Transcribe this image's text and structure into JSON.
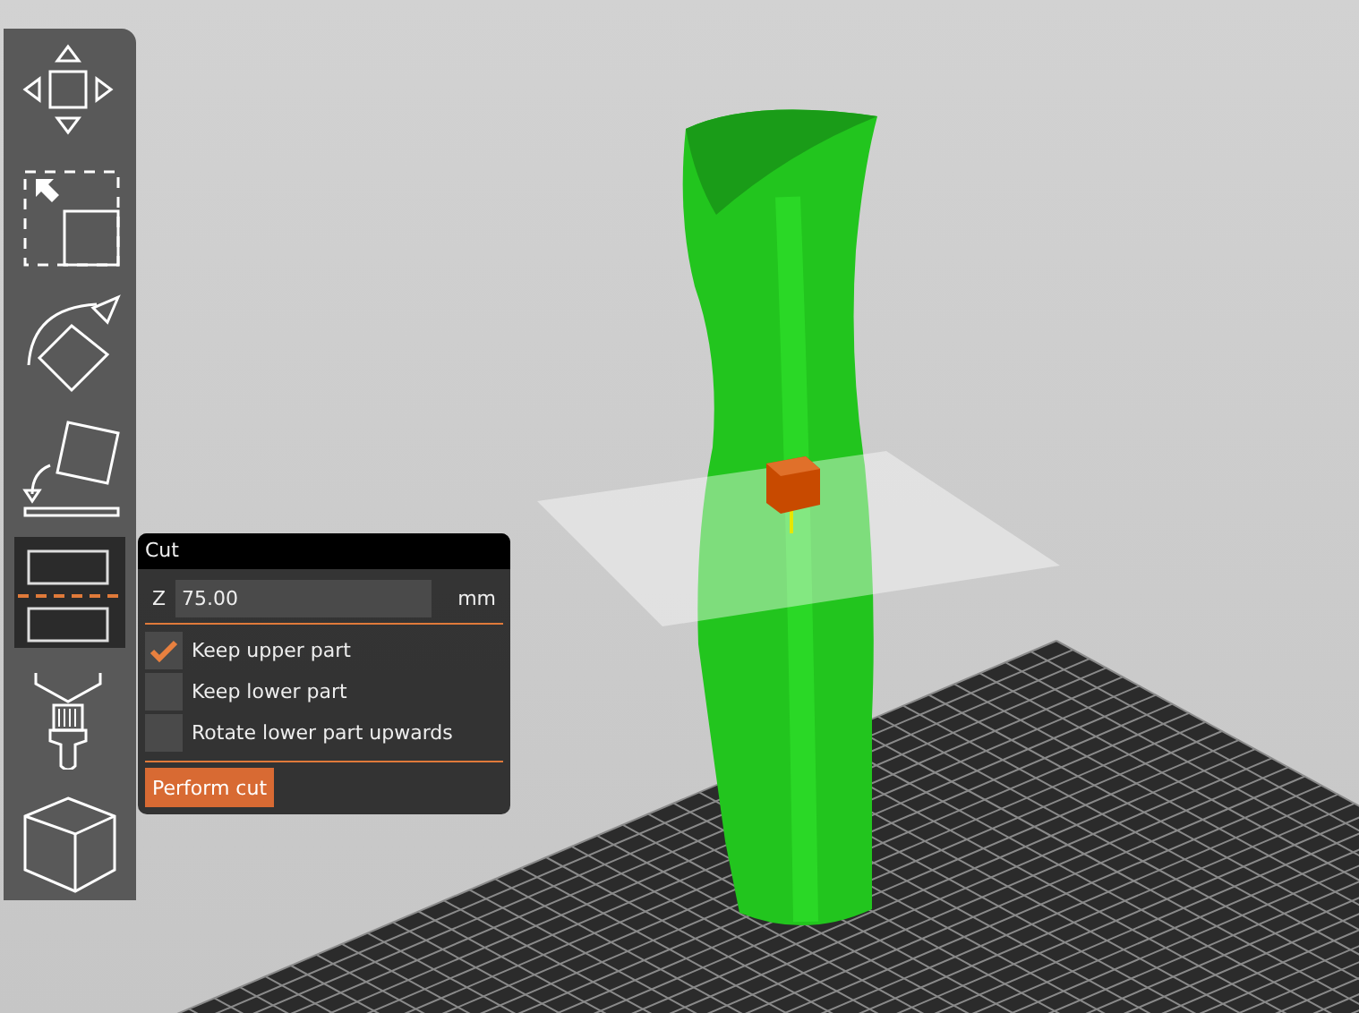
{
  "toolbar": {
    "tools": [
      {
        "kind": "move",
        "selected": false
      },
      {
        "kind": "scale",
        "selected": false
      },
      {
        "kind": "rotate",
        "selected": false
      },
      {
        "kind": "place",
        "selected": false
      },
      {
        "kind": "cut",
        "selected": true
      },
      {
        "kind": "paint",
        "selected": false
      },
      {
        "kind": "cube",
        "selected": false
      }
    ]
  },
  "cut_panel": {
    "title": "Cut",
    "z_label": "Z",
    "z_value": "75.00",
    "unit": "mm",
    "options": [
      {
        "label": "Keep upper part",
        "checked": true
      },
      {
        "label": "Keep lower part",
        "checked": false
      },
      {
        "label": "Rotate lower part upwards",
        "checked": false
      }
    ],
    "button": "Perform cut"
  }
}
